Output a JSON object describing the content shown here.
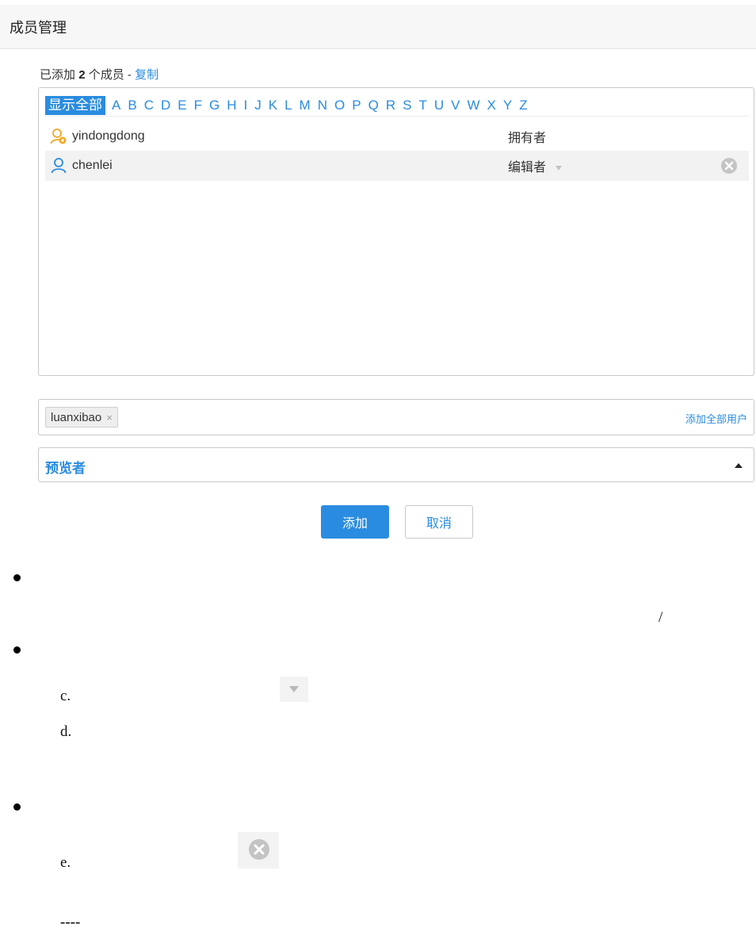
{
  "dialog": {
    "title": "成员管理"
  },
  "summary": {
    "prefix": "已添加",
    "count": "2",
    "suffix": "个成员",
    "separator": "-",
    "copy_label": "复制"
  },
  "alphabet": {
    "all_label": "显示全部",
    "letters": [
      "A",
      "B",
      "C",
      "D",
      "E",
      "F",
      "G",
      "H",
      "I",
      "J",
      "K",
      "L",
      "M",
      "N",
      "O",
      "P",
      "Q",
      "R",
      "S",
      "T",
      "U",
      "V",
      "W",
      "X",
      "Y",
      "Z"
    ]
  },
  "members": [
    {
      "name": "yindongdong",
      "role": "拥有者",
      "icon": "owner-user-icon",
      "removable": false
    },
    {
      "name": "chenlei",
      "role": "编辑者",
      "icon": "user-icon",
      "removable": true
    }
  ],
  "user_input": {
    "tag": "luanxibao",
    "tag_remove": "×",
    "add_all_label": "添加全部用户"
  },
  "role_select": {
    "value": "预览者"
  },
  "buttons": {
    "add": "添加",
    "cancel": "取消"
  },
  "doc": {
    "slash": "/",
    "item_c": "c.",
    "item_d": "d.",
    "item_e": "e.",
    "dash": "----"
  },
  "colors": {
    "accent": "#2a8ce0",
    "owner_icon": "#f5a623",
    "user_icon": "#2a8ce0"
  }
}
